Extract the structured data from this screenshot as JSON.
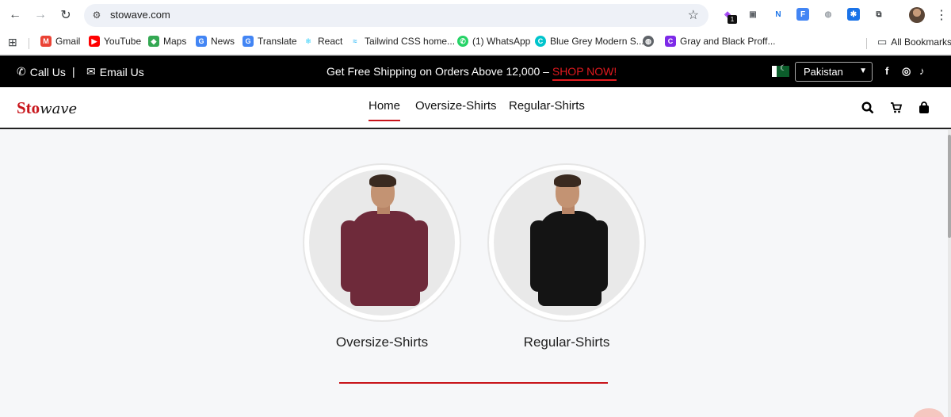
{
  "browser": {
    "url": "stowave.com",
    "extension_badge": "1",
    "bookmarks": [
      {
        "label": "Gmail",
        "icon": "gmail-icon",
        "color": "#ea4335"
      },
      {
        "label": "YouTube",
        "icon": "youtube-icon",
        "color": "#ff0000"
      },
      {
        "label": "Maps",
        "icon": "maps-icon",
        "color": "#34a853"
      },
      {
        "label": "News",
        "icon": "news-icon",
        "color": "#4285f4"
      },
      {
        "label": "Translate",
        "icon": "translate-icon",
        "color": "#4285f4"
      },
      {
        "label": "React",
        "icon": "react-icon",
        "color": "#61dafb"
      },
      {
        "label": "Tailwind CSS home...",
        "icon": "tailwind-icon",
        "color": "#38bdf8"
      },
      {
        "label": "(1) WhatsApp",
        "icon": "whatsapp-icon",
        "color": "#25d366"
      },
      {
        "label": "Blue Grey Modern S...",
        "icon": "canva-icon",
        "color": "#00c4cc"
      },
      {
        "label": "Gray and Black Proff...",
        "icon": "canva-icon",
        "color": "#7d2ae8"
      }
    ],
    "all_bookmarks": "All Bookmarks"
  },
  "topbar": {
    "call": "Call Us",
    "divider": "|",
    "email": "Email Us",
    "promo": "Get Free Shipping on Orders Above 12,000 – ",
    "shop_now": "SHOP NOW!",
    "country": "Pakistan"
  },
  "header": {
    "logo_red": "Sto",
    "logo_black": "wave",
    "nav": [
      "Home",
      "Oversize-Shirts",
      "Regular-Shirts"
    ]
  },
  "categories": [
    {
      "label": "Oversize-Shirts",
      "shirt_color": "#6e2a3a"
    },
    {
      "label": "Regular-Shirts",
      "shirt_color": "#141414"
    }
  ],
  "colors": {
    "accent": "#c8141a",
    "topbar_bg": "#000000"
  }
}
